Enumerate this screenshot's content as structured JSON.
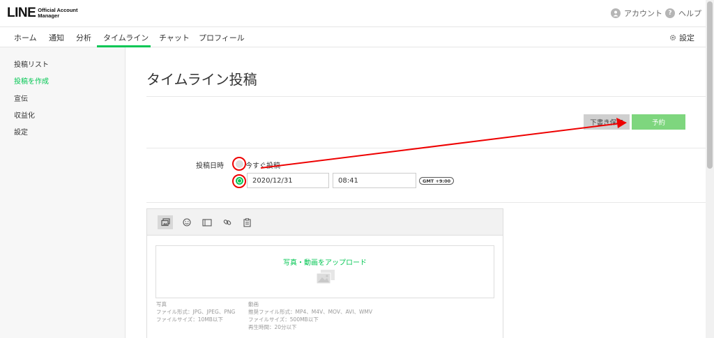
{
  "header": {
    "logo_big": "LINE",
    "logo_small_line1": "Official Account",
    "logo_small_line2": "Manager",
    "account_label": "アカウント",
    "help_label": "ヘルプ",
    "help_icon_char": "?"
  },
  "tabs": [
    {
      "label": "ホーム"
    },
    {
      "label": "通知"
    },
    {
      "label": "分析"
    },
    {
      "label": "タイムライン"
    },
    {
      "label": "チャット"
    },
    {
      "label": "プロフィール"
    }
  ],
  "tabs_active": "タイムライン",
  "settings_label": "設定",
  "sidebar": {
    "items": [
      {
        "label": "投稿リスト"
      },
      {
        "label": "投稿を作成",
        "active": true
      },
      {
        "label": "宣伝"
      },
      {
        "label": "収益化"
      },
      {
        "label": "設定"
      }
    ]
  },
  "main": {
    "title": "タイムライン投稿",
    "draft_button": "下書き保存",
    "schedule_button": "予約",
    "post_datetime_label": "投稿日時",
    "now_option": "今すぐ投稿",
    "date_value": "2020/12/31",
    "time_value": "08:41",
    "timezone": "GMT +9:00",
    "upload_text": "写真・動画をアップロード",
    "photo": {
      "heading": "写真",
      "formats": "ファイル形式：JPG、JPEG、PNG",
      "size": "ファイルサイズ：10MB以下"
    },
    "video": {
      "heading": "動画",
      "formats": "推奨ファイル形式：MP4、M4V、MOV、AVI、WMV",
      "size": "ファイルサイズ：500MB以下",
      "duration": "再生時間：20分以下"
    }
  },
  "colors": {
    "accent": "#06c755",
    "schedule_button": "#7ed67e",
    "annotation": "#e00000"
  }
}
